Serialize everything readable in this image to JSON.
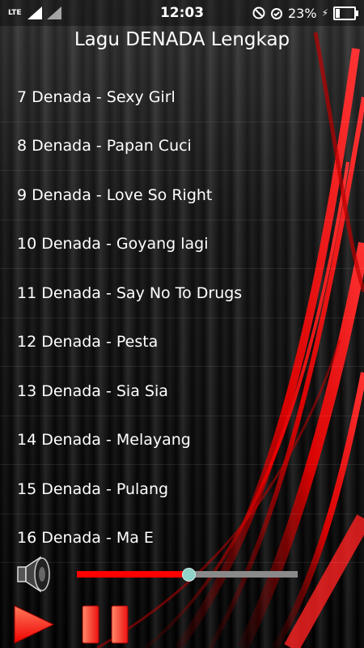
{
  "status_bar": {
    "network": "LTE",
    "time": "12:03",
    "battery_percent": "23%",
    "battery_level": 0.23,
    "icons": [
      "signal-icon",
      "signal-icon",
      "do-not-disturb-icon",
      "alarm-icon",
      "battery-icon",
      "charging-icon"
    ]
  },
  "header": {
    "title": "Lagu DENADA Lengkap"
  },
  "songs": [
    "7 Denada - Sexy Girl",
    "8 Denada - Papan Cuci",
    "9 Denada - Love So Right",
    "10 Denada - Goyang lagi",
    "11 Denada - Say No To Drugs",
    "12 Denada - Pesta",
    "13 Denada - Sia Sia",
    "14 Denada - Melayang",
    "15 Denada - Pulang",
    "16 Denada - Ma E"
  ],
  "player": {
    "progress": 0.5,
    "colors": {
      "seek_fill": "#ff0000",
      "seek_track": "#8a8a8a",
      "thumb": "#8fd2c8",
      "play": "#ff2a1a"
    },
    "icons": {
      "volume": "speaker-icon",
      "play": "play-icon",
      "pause": "pause-icon"
    }
  }
}
